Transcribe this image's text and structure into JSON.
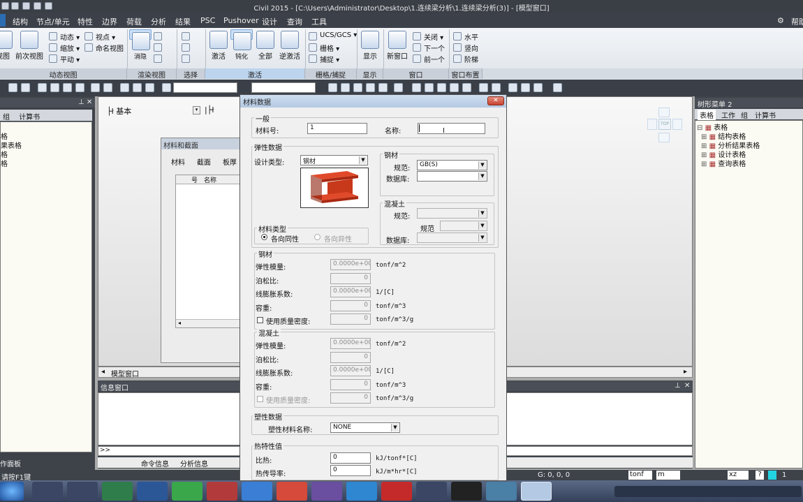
{
  "window": {
    "title": "Civil 2015 - [C:\\Users\\Administrator\\Desktop\\1.连续梁分析\\1.连续梁分析(3)] - [模型窗口]",
    "help_label": "帮助"
  },
  "menu": [
    "结构",
    "节点/单元",
    "特性",
    "边界",
    "荷载",
    "分析",
    "结果",
    "PSC",
    "Pushover",
    "设计",
    "查询",
    "工具"
  ],
  "ribbon": {
    "big_buttons": [
      "视图",
      "前次视图",
      "消隐",
      "激活",
      "钝化",
      "全部",
      "逆激活",
      "显示",
      "新窗口"
    ],
    "small_items": {
      "dynamic": [
        "动态",
        "缩放",
        "平动"
      ],
      "views": [
        "视点",
        "命名视图"
      ],
      "ucs": [
        "UCS/GCS",
        "栅格",
        "捕捉"
      ],
      "window": [
        "关闭",
        "下一个",
        "前一个"
      ],
      "layout": [
        "水平",
        "竖向",
        "阶梯"
      ]
    },
    "groups": [
      "动态视图",
      "渲染视图",
      "选择",
      "激活",
      "栅格/捕捉",
      "显示",
      "窗口",
      "窗口布置"
    ]
  },
  "left_panel": {
    "tabs": [
      "组",
      "计算书"
    ],
    "items": [
      "格",
      "果表格",
      "格",
      "格"
    ],
    "bottom_label": "作面板"
  },
  "model_window": {
    "view_name": "基本",
    "tab": "模型窗口",
    "view_cube_label": "TOP"
  },
  "material_section_dialog": {
    "title": "材料和截面",
    "tabs": [
      "材料",
      "截面",
      "板厚"
    ],
    "columns": [
      "号",
      "名称"
    ]
  },
  "info_window": {
    "title": "信息窗口",
    "prompt": ">>",
    "tabs": [
      "命令信息",
      "分析信息"
    ]
  },
  "tree_menu": {
    "title": "树形菜单 2",
    "tabs": [
      "表格",
      "工作",
      "组",
      "计算书"
    ],
    "root": "表格",
    "items": [
      "结构表格",
      "分析结果表格",
      "设计表格",
      "查询表格"
    ]
  },
  "material_dialog": {
    "title": "材料数据",
    "general": {
      "label": "一般",
      "id_label": "材料号:",
      "id_value": "1",
      "name_label": "名称:",
      "name_value": ""
    },
    "elastic": {
      "label": "弹性数据",
      "design_type_label": "设计类型:",
      "design_type_value": "钢材",
      "steel_group": "钢材",
      "steel_code_label": "规范:",
      "steel_code_value": "GB(S)",
      "steel_db_label": "数据库:",
      "concrete_group": "混凝土",
      "concrete_code_label": "规范:",
      "concrete_code2_label": "规范",
      "concrete_db_label": "数据库:",
      "material_type_label": "材料类型",
      "isotropic": "各向同性",
      "anisotropic": "各向异性"
    },
    "steel_props": {
      "label": "钢材",
      "rows": [
        {
          "label": "弹性模量:",
          "value": "0.0000e+000",
          "unit": "tonf/m^2"
        },
        {
          "label": "泊松比:",
          "value": "0",
          "unit": ""
        },
        {
          "label": "线膨胀系数:",
          "value": "0.0000e+000",
          "unit": "1/[C]"
        },
        {
          "label": "容重:",
          "value": "0",
          "unit": "tonf/m^3"
        },
        {
          "label": "使用质量密度:",
          "value": "0",
          "unit": "tonf/m^3/g"
        }
      ]
    },
    "concrete_props": {
      "label": "混凝土",
      "rows": [
        {
          "label": "弹性模量:",
          "value": "0.0000e+000",
          "unit": "tonf/m^2"
        },
        {
          "label": "泊松比:",
          "value": "0",
          "unit": ""
        },
        {
          "label": "线膨胀系数:",
          "value": "0.0000e+000",
          "unit": "1/[C]"
        },
        {
          "label": "容重:",
          "value": "0",
          "unit": "tonf/m^3"
        },
        {
          "label": "使用质量密度:",
          "value": "0",
          "unit": "tonf/m^3/g"
        }
      ]
    },
    "plastic": {
      "label": "塑性数据",
      "name_label": "塑性材料名称:",
      "name_value": "NONE"
    },
    "thermal": {
      "label": "热特性值",
      "specific_heat_label": "比热:",
      "specific_heat_value": "0",
      "specific_heat_unit": "kJ/tonf*[C]",
      "conductivity_label": "热传导率:",
      "conductivity_value": "0",
      "conductivity_unit": "kJ/m*hr*[C]"
    }
  },
  "status_bar": {
    "hint": "请按F1键",
    "coords": "G: 0, 0, 0",
    "force_unit": "tonf",
    "length_unit": "m",
    "plane": "xz",
    "help": "?",
    "page": "1"
  }
}
